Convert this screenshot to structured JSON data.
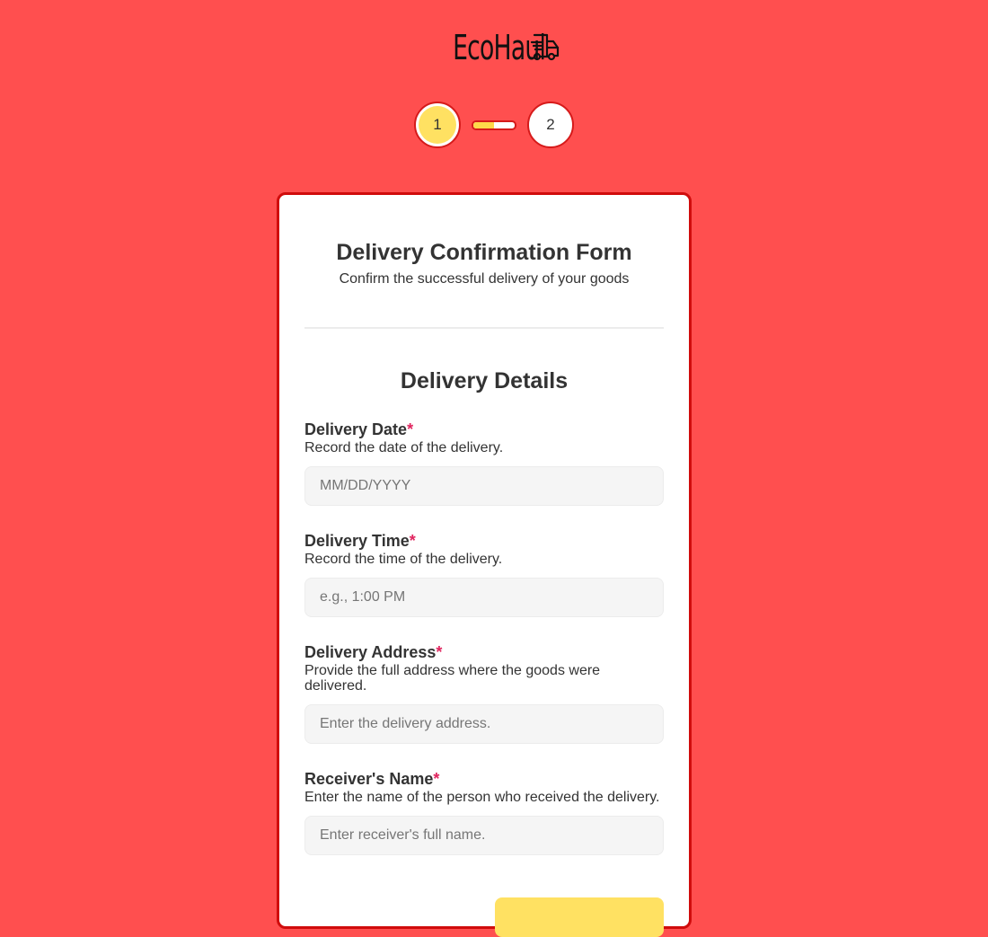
{
  "brand": {
    "name": "EcoHaul",
    "icon": "delivery-truck-icon"
  },
  "stepper": {
    "steps": [
      {
        "label": "1",
        "state": "active"
      },
      {
        "label": "2",
        "state": "inactive"
      }
    ],
    "progress_fraction": 0.5,
    "colors": {
      "active": "#ffe162",
      "border": "#d61a1a"
    }
  },
  "form": {
    "title": "Delivery Confirmation Form",
    "subtitle": "Confirm the successful delivery of your goods",
    "section_title": "Delivery Details",
    "required_marker": "*",
    "fields": [
      {
        "label": "Delivery Date",
        "help": "Record the date of the delivery.",
        "placeholder": "MM/DD/YYYY",
        "value": ""
      },
      {
        "label": "Delivery Time",
        "help": "Record the time of the delivery.",
        "placeholder": "e.g., 1:00 PM",
        "value": ""
      },
      {
        "label": "Delivery Address",
        "help": "Provide the full address where the goods were delivered.",
        "placeholder": "Enter the delivery address.",
        "value": ""
      },
      {
        "label": "Receiver's Name",
        "help": "Enter the name of the person who received the delivery.",
        "placeholder": "Enter receiver's full name.",
        "value": ""
      }
    ]
  },
  "colors": {
    "background": "#ff4f4f",
    "card_border": "#d00c0c",
    "accent": "#ffe162",
    "required": "#e0245e"
  }
}
